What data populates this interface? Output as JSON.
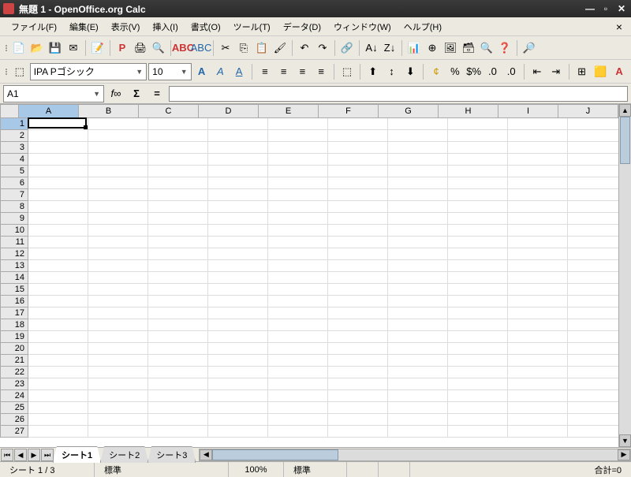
{
  "window": {
    "title": "無題 1 - OpenOffice.org Calc"
  },
  "menu": {
    "file": "ファイル(F)",
    "edit": "編集(E)",
    "view": "表示(V)",
    "insert": "挿入(I)",
    "format": "書式(O)",
    "tools": "ツール(T)",
    "data": "データ(D)",
    "window": "ウィンドウ(W)",
    "help": "ヘルプ(H)"
  },
  "font": {
    "name": "IPA Pゴシック",
    "size": "10"
  },
  "namebox": {
    "ref": "A1"
  },
  "formula": {
    "value": ""
  },
  "columns": [
    "A",
    "B",
    "C",
    "D",
    "E",
    "F",
    "G",
    "H",
    "I",
    "J"
  ],
  "rows": [
    "1",
    "2",
    "3",
    "4",
    "5",
    "6",
    "7",
    "8",
    "9",
    "10",
    "11",
    "12",
    "13",
    "14",
    "15",
    "16",
    "17",
    "18",
    "19",
    "20",
    "21",
    "22",
    "23",
    "24",
    "25",
    "26",
    "27"
  ],
  "tabs": {
    "s1": "シート1",
    "s2": "シート2",
    "s3": "シート3",
    "active": 0
  },
  "status": {
    "sheet": "シート 1 / 3",
    "style": "標準",
    "zoom": "100%",
    "mode": "標準",
    "sum": "合計=0"
  }
}
